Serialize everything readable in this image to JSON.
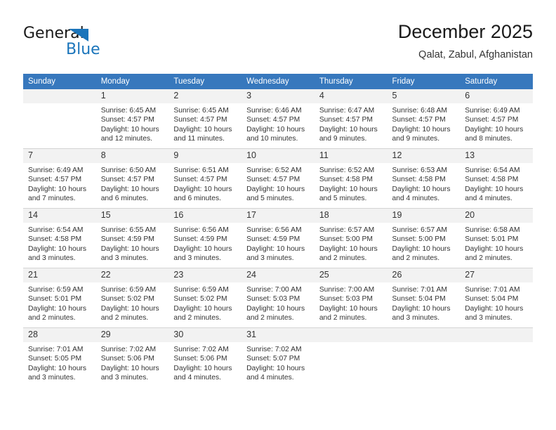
{
  "brand": {
    "name_part1": "General",
    "name_part2": "Blue",
    "triangle_color": "#1b75bb"
  },
  "header": {
    "title": "December 2025",
    "subtitle": "Qalat, Zabul, Afghanistan",
    "accent_color": "#3778bd"
  },
  "calendar": {
    "weekday_headers": [
      "Sunday",
      "Monday",
      "Tuesday",
      "Wednesday",
      "Thursday",
      "Friday",
      "Saturday"
    ],
    "weeks": [
      [
        {
          "day": "",
          "lines": []
        },
        {
          "day": "1",
          "lines": [
            "Sunrise: 6:45 AM",
            "Sunset: 4:57 PM",
            "Daylight: 10 hours",
            "and 12 minutes."
          ]
        },
        {
          "day": "2",
          "lines": [
            "Sunrise: 6:45 AM",
            "Sunset: 4:57 PM",
            "Daylight: 10 hours",
            "and 11 minutes."
          ]
        },
        {
          "day": "3",
          "lines": [
            "Sunrise: 6:46 AM",
            "Sunset: 4:57 PM",
            "Daylight: 10 hours",
            "and 10 minutes."
          ]
        },
        {
          "day": "4",
          "lines": [
            "Sunrise: 6:47 AM",
            "Sunset: 4:57 PM",
            "Daylight: 10 hours",
            "and 9 minutes."
          ]
        },
        {
          "day": "5",
          "lines": [
            "Sunrise: 6:48 AM",
            "Sunset: 4:57 PM",
            "Daylight: 10 hours",
            "and 9 minutes."
          ]
        },
        {
          "day": "6",
          "lines": [
            "Sunrise: 6:49 AM",
            "Sunset: 4:57 PM",
            "Daylight: 10 hours",
            "and 8 minutes."
          ]
        }
      ],
      [
        {
          "day": "7",
          "lines": [
            "Sunrise: 6:49 AM",
            "Sunset: 4:57 PM",
            "Daylight: 10 hours",
            "and 7 minutes."
          ]
        },
        {
          "day": "8",
          "lines": [
            "Sunrise: 6:50 AM",
            "Sunset: 4:57 PM",
            "Daylight: 10 hours",
            "and 6 minutes."
          ]
        },
        {
          "day": "9",
          "lines": [
            "Sunrise: 6:51 AM",
            "Sunset: 4:57 PM",
            "Daylight: 10 hours",
            "and 6 minutes."
          ]
        },
        {
          "day": "10",
          "lines": [
            "Sunrise: 6:52 AM",
            "Sunset: 4:57 PM",
            "Daylight: 10 hours",
            "and 5 minutes."
          ]
        },
        {
          "day": "11",
          "lines": [
            "Sunrise: 6:52 AM",
            "Sunset: 4:58 PM",
            "Daylight: 10 hours",
            "and 5 minutes."
          ]
        },
        {
          "day": "12",
          "lines": [
            "Sunrise: 6:53 AM",
            "Sunset: 4:58 PM",
            "Daylight: 10 hours",
            "and 4 minutes."
          ]
        },
        {
          "day": "13",
          "lines": [
            "Sunrise: 6:54 AM",
            "Sunset: 4:58 PM",
            "Daylight: 10 hours",
            "and 4 minutes."
          ]
        }
      ],
      [
        {
          "day": "14",
          "lines": [
            "Sunrise: 6:54 AM",
            "Sunset: 4:58 PM",
            "Daylight: 10 hours",
            "and 3 minutes."
          ]
        },
        {
          "day": "15",
          "lines": [
            "Sunrise: 6:55 AM",
            "Sunset: 4:59 PM",
            "Daylight: 10 hours",
            "and 3 minutes."
          ]
        },
        {
          "day": "16",
          "lines": [
            "Sunrise: 6:56 AM",
            "Sunset: 4:59 PM",
            "Daylight: 10 hours",
            "and 3 minutes."
          ]
        },
        {
          "day": "17",
          "lines": [
            "Sunrise: 6:56 AM",
            "Sunset: 4:59 PM",
            "Daylight: 10 hours",
            "and 3 minutes."
          ]
        },
        {
          "day": "18",
          "lines": [
            "Sunrise: 6:57 AM",
            "Sunset: 5:00 PM",
            "Daylight: 10 hours",
            "and 2 minutes."
          ]
        },
        {
          "day": "19",
          "lines": [
            "Sunrise: 6:57 AM",
            "Sunset: 5:00 PM",
            "Daylight: 10 hours",
            "and 2 minutes."
          ]
        },
        {
          "day": "20",
          "lines": [
            "Sunrise: 6:58 AM",
            "Sunset: 5:01 PM",
            "Daylight: 10 hours",
            "and 2 minutes."
          ]
        }
      ],
      [
        {
          "day": "21",
          "lines": [
            "Sunrise: 6:59 AM",
            "Sunset: 5:01 PM",
            "Daylight: 10 hours",
            "and 2 minutes."
          ]
        },
        {
          "day": "22",
          "lines": [
            "Sunrise: 6:59 AM",
            "Sunset: 5:02 PM",
            "Daylight: 10 hours",
            "and 2 minutes."
          ]
        },
        {
          "day": "23",
          "lines": [
            "Sunrise: 6:59 AM",
            "Sunset: 5:02 PM",
            "Daylight: 10 hours",
            "and 2 minutes."
          ]
        },
        {
          "day": "24",
          "lines": [
            "Sunrise: 7:00 AM",
            "Sunset: 5:03 PM",
            "Daylight: 10 hours",
            "and 2 minutes."
          ]
        },
        {
          "day": "25",
          "lines": [
            "Sunrise: 7:00 AM",
            "Sunset: 5:03 PM",
            "Daylight: 10 hours",
            "and 2 minutes."
          ]
        },
        {
          "day": "26",
          "lines": [
            "Sunrise: 7:01 AM",
            "Sunset: 5:04 PM",
            "Daylight: 10 hours",
            "and 3 minutes."
          ]
        },
        {
          "day": "27",
          "lines": [
            "Sunrise: 7:01 AM",
            "Sunset: 5:04 PM",
            "Daylight: 10 hours",
            "and 3 minutes."
          ]
        }
      ],
      [
        {
          "day": "28",
          "lines": [
            "Sunrise: 7:01 AM",
            "Sunset: 5:05 PM",
            "Daylight: 10 hours",
            "and 3 minutes."
          ]
        },
        {
          "day": "29",
          "lines": [
            "Sunrise: 7:02 AM",
            "Sunset: 5:06 PM",
            "Daylight: 10 hours",
            "and 3 minutes."
          ]
        },
        {
          "day": "30",
          "lines": [
            "Sunrise: 7:02 AM",
            "Sunset: 5:06 PM",
            "Daylight: 10 hours",
            "and 4 minutes."
          ]
        },
        {
          "day": "31",
          "lines": [
            "Sunrise: 7:02 AM",
            "Sunset: 5:07 PM",
            "Daylight: 10 hours",
            "and 4 minutes."
          ]
        },
        {
          "day": "",
          "lines": []
        },
        {
          "day": "",
          "lines": []
        },
        {
          "day": "",
          "lines": []
        }
      ]
    ]
  }
}
